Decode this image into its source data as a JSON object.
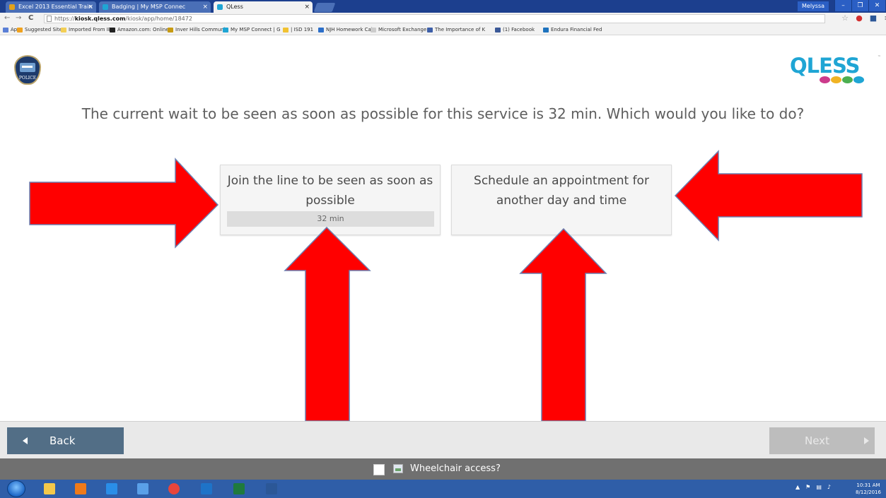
{
  "browser": {
    "tabs": [
      {
        "label": "Excel 2013 Essential Train",
        "color": "#e3a21a"
      },
      {
        "label": "Badging | My MSP Connec",
        "color": "#1fa5d4"
      },
      {
        "label": "QLess",
        "color": "#1fa5d4"
      }
    ],
    "user": "Melyssa",
    "window_buttons": [
      "–",
      "❐",
      "✕"
    ],
    "url_prefix": "https://",
    "url_host": "kiosk.qless.com",
    "url_path": "/kiosk/app/home/18472",
    "bookmarks": [
      {
        "label": "Apps",
        "color": "#5a7fd6"
      },
      {
        "label": "Suggested Sites",
        "color": "#f0a21e"
      },
      {
        "label": "Imported From IE",
        "color": "#f3cf55"
      },
      {
        "label": "Amazon.com: Online",
        "color": "#222222"
      },
      {
        "label": "Inver Hills Communit",
        "color": "#c79b12"
      },
      {
        "label": "My MSP Connect | G",
        "color": "#1fa5d4"
      },
      {
        "label": "| ISD 191",
        "color": "#f1c232"
      },
      {
        "label": "NJH Homework Cale",
        "color": "#2c6fc9"
      },
      {
        "label": "Microsoft Exchange",
        "color": "#cccccc"
      },
      {
        "label": "The Importance of K",
        "color": "#3d5fa8"
      },
      {
        "label": "(1) Facebook",
        "color": "#3b5998"
      },
      {
        "label": "Endura Financial Fed",
        "color": "#1e73be"
      }
    ]
  },
  "page": {
    "org_logo_text": "POLICE",
    "brand": "QLESS",
    "brand_tm": "™",
    "brand_dot_colors": [
      "#cc3b8c",
      "#f0b323",
      "#4caf50",
      "#1fa5d4"
    ],
    "question": "The current wait to be seen as soon as possible for this service is 32 min. Which would you like to do?",
    "option_join": "Join the line to be seen as soon as possible",
    "option_join_wait": "32 min",
    "option_schedule": "Schedule an appointment for another day and time",
    "annotation_arrow_color": "#ff0000"
  },
  "footer": {
    "back_label": "Back",
    "next_label": "Next",
    "wheelchair_label": "Wheelchair access?"
  },
  "taskbar": {
    "apps": [
      {
        "name": "explorer",
        "color": "#f4c84a"
      },
      {
        "name": "media-player",
        "color": "#ef7a1a"
      },
      {
        "name": "internet-explorer",
        "color": "#2a8ee8"
      },
      {
        "name": "notes",
        "color": "#5aa0e8"
      },
      {
        "name": "chrome",
        "color": "#e8453c"
      },
      {
        "name": "outlook",
        "color": "#1e73c8"
      },
      {
        "name": "excel",
        "color": "#1f7a3d"
      },
      {
        "name": "word",
        "color": "#2b5797"
      }
    ],
    "time": "10:31 AM",
    "date": "8/12/2016"
  }
}
